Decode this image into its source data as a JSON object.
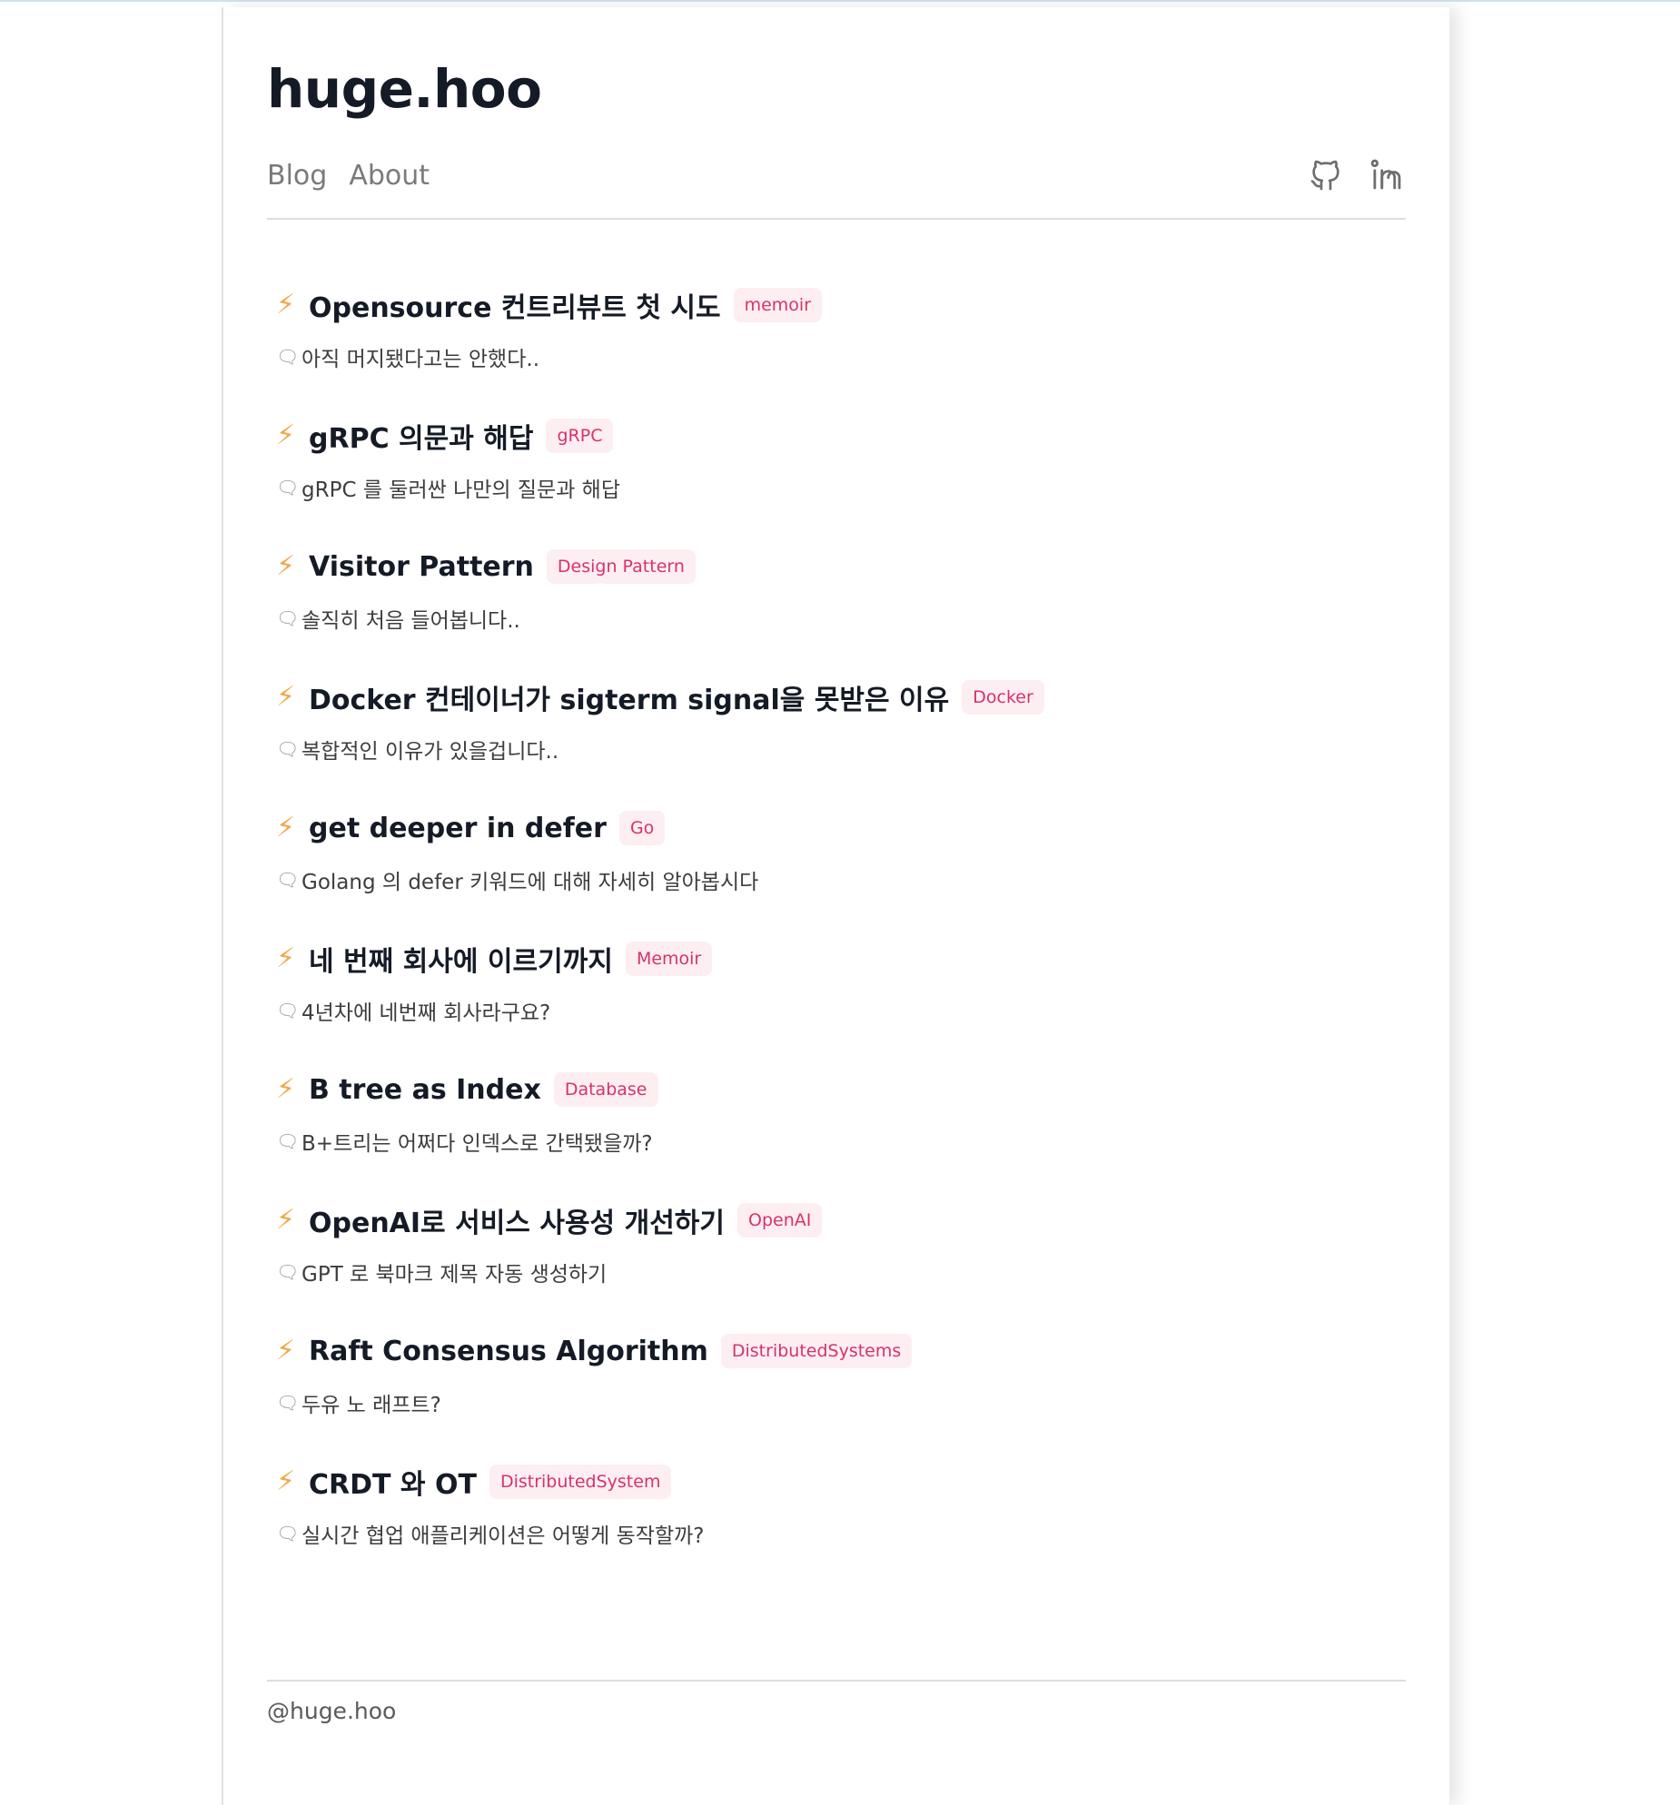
{
  "site": {
    "title": "huge.hoo",
    "footer": "@huge.hoo"
  },
  "nav": {
    "items": [
      "Blog",
      "About"
    ]
  },
  "social": {
    "icons": [
      "github-icon",
      "linkedin-icon"
    ]
  },
  "colors": {
    "accent_tag_bg": "#fdeef2",
    "accent_tag_text": "#d6336c",
    "bolt": "#f0a94a"
  },
  "posts": [
    {
      "title": "Opensource 컨트리뷰트 첫 시도",
      "tag": "memoir",
      "desc": "아직 머지됐다고는 안했다.."
    },
    {
      "title": "gRPC 의문과 해답",
      "tag": "gRPC",
      "desc": "gRPC 를 둘러싼 나만의 질문과 해답"
    },
    {
      "title": "Visitor Pattern",
      "tag": "Design Pattern",
      "desc": "솔직히 처음 들어봅니다.."
    },
    {
      "title": "Docker 컨테이너가 sigterm signal을 못받은 이유",
      "tag": "Docker",
      "desc": "복합적인 이유가 있을겁니다.."
    },
    {
      "title": "get deeper in defer",
      "tag": "Go",
      "desc": "Golang 의 defer 키워드에 대해 자세히 알아봅시다"
    },
    {
      "title": "네 번째 회사에 이르기까지",
      "tag": "Memoir",
      "desc": "4년차에 네번째 회사라구요?"
    },
    {
      "title": "B tree as Index",
      "tag": "Database",
      "desc": "B+트리는 어쩌다 인덱스로 간택됐을까?"
    },
    {
      "title": "OpenAI로 서비스 사용성 개선하기",
      "tag": "OpenAI",
      "desc": "GPT 로 북마크 제목 자동 생성하기"
    },
    {
      "title": "Raft Consensus Algorithm",
      "tag": "DistributedSystems",
      "desc": "두유 노 래프트?"
    },
    {
      "title": "CRDT 와 OT",
      "tag": "DistributedSystem",
      "desc": "실시간 협업 애플리케이션은 어떻게 동작할까?"
    }
  ]
}
